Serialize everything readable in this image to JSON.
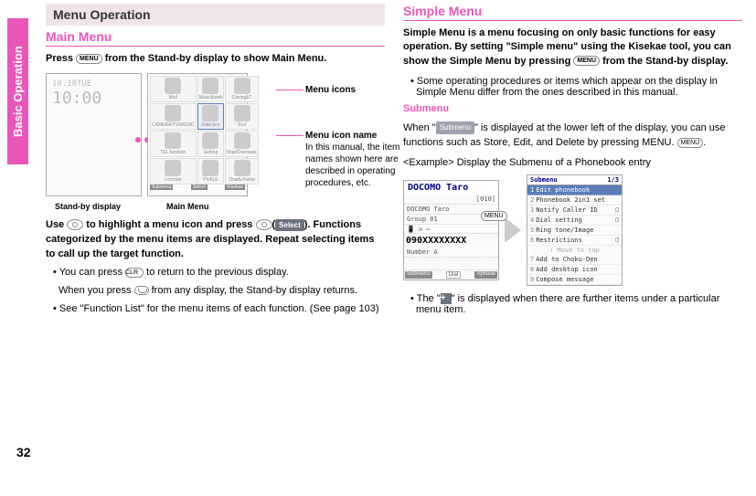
{
  "sidebar": {
    "label": "Basic Operation"
  },
  "page_number": "32",
  "left": {
    "section_title": "Menu Operation",
    "main_menu_heading": "Main Menu",
    "intro": "Press MENU from the Stand-by display to show Main Menu.",
    "standby": {
      "date": "10.18TUE",
      "time": "10:00"
    },
    "menu_cells": [
      "Mail",
      "Music&web",
      "Casing&?",
      "CAMERA/TV/MUSIC",
      "Data box",
      "Tool",
      "TEL function",
      "Setting",
      "Map/Overseas",
      "i-concier",
      "ProfiLE",
      "Osaifu-Keitai"
    ],
    "menu_bottom": {
      "left": "Submenu",
      "center": "Select",
      "right": "Kisekae\\nPrivate"
    },
    "callout1": "Menu icons",
    "callout2_title": "Menu icon name",
    "callout2_body": "In this manual, the item names shown here are described in operating procedures, etc.",
    "caption_left": "Stand-by display",
    "caption_right": "Main Menu",
    "use_text": "Use ◎ to highlight a menu icon and press ◎(Select). Functions categorized by the menu items are displayed. Repeat selecting items to call up the target function.",
    "bullet1a": "You can press CLR to return to the previous display.",
    "bullet1b": "When you press ⌂ from any display, the Stand-by display returns.",
    "bullet2": "See \"Function List\" for the menu items of each function. (See page 103)"
  },
  "right": {
    "heading": "Simple Menu",
    "intro": "Simple Menu is a menu focusing on only basic functions for easy operation. By setting \"Simple menu\" using the Kisekae tool, you can show the Simple Menu by pressing MENU from the Stand-by display.",
    "bullet1": "Some operating procedures or items which appear on the display in Simple Menu differ from the ones described in this manual.",
    "submenu_heading": "Submenu",
    "submenu_text1_a": "When \"",
    "submenu_text1_b": "\" is displayed at the lower left of the display, you can use functions such as Store, Edit, and Delete by pressing MENU.",
    "submenu_badge": "Submenu",
    "example_label": "<Example> Display the Submenu of a Phonebook entry",
    "phonebook": {
      "title": "DOCOMO Taro",
      "memory": "[010]",
      "sub": "DOCOMO Taro",
      "group": "Group 01",
      "number": "090XXXXXXXX",
      "field": "Number A",
      "bottom_left": "Submenu",
      "bottom_center": "Dial",
      "bottom_right": "Vphone\\nKoutaku"
    },
    "arrow_key": "MENU",
    "submenu_screen": {
      "title": "Submenu",
      "page": "1/3",
      "items": [
        {
          "n": "1",
          "t": "Edit phonebook",
          "hl": true
        },
        {
          "n": "2",
          "t": "Phonebook 2in1 set"
        },
        {
          "n": "3",
          "t": "Notify Caller ID",
          "box": "□"
        },
        {
          "n": "4",
          "t": "Dial setting",
          "box": "□"
        },
        {
          "n": "5",
          "t": "Ring tone/Image"
        },
        {
          "n": "6",
          "t": "Restrictions",
          "box": "□"
        }
      ],
      "mid": "↑ Move to top",
      "tail": [
        {
          "n": "7",
          "t": "Add to Choku-Den"
        },
        {
          "n": "8",
          "t": "Add desktop icon"
        },
        {
          "n": "9",
          "t": "Compose message"
        }
      ]
    },
    "bullet2_a": "The \"",
    "bullet2_b": "\" is displayed when there are further items under a particular menu item."
  }
}
